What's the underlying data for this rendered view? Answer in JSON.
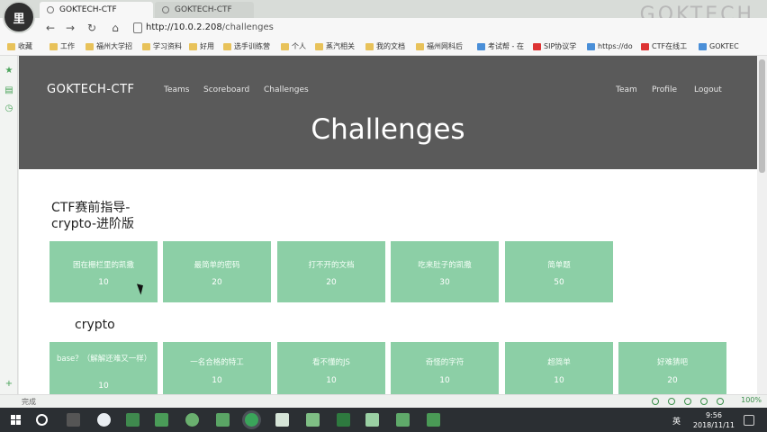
{
  "avatar": {
    "text": "里"
  },
  "tabs": [
    {
      "label": "GOKTECH-CTF"
    },
    {
      "label": "GOKTECH-CTF"
    }
  ],
  "watermark": "GOKTECH",
  "address": {
    "host": "http://10.0.2.208",
    "path": "/challenges"
  },
  "bookmarks": [
    {
      "label": "收藏",
      "icon": "star-icon"
    },
    {
      "label": "工作",
      "icon": "folder-icon"
    },
    {
      "label": "福州大学招",
      "icon": "folder-icon"
    },
    {
      "label": "学习资料",
      "icon": "folder-icon"
    },
    {
      "label": "好用",
      "icon": "folder-icon"
    },
    {
      "label": "选手训练营",
      "icon": "folder-icon"
    },
    {
      "label": "个人",
      "icon": "folder-icon"
    },
    {
      "label": "蒸汽相关",
      "icon": "folder-icon"
    },
    {
      "label": "我的文档",
      "icon": "folder-icon"
    },
    {
      "label": "福州网科后",
      "icon": "folder-icon"
    },
    {
      "label": "考试帮 - 在",
      "icon": "page-icon"
    },
    {
      "label": "SIP协议学",
      "icon": "page-icon"
    },
    {
      "label": "https://do",
      "icon": "page-icon"
    },
    {
      "label": "CTF在线工",
      "icon": "page-icon"
    },
    {
      "label": "GOKTEC",
      "icon": "page-icon"
    }
  ],
  "site": {
    "brand": "GOKTECH-CTF",
    "nav_left": [
      "Teams",
      "Scoreboard",
      "Challenges"
    ],
    "nav_right": [
      "Team",
      "Profile",
      "Logout"
    ],
    "hero_title": "Challenges"
  },
  "categories": [
    {
      "title": "CTF赛前指导-crypto-进阶版",
      "challenges": [
        {
          "name": "困在栅栏里的凯撒",
          "points": "10"
        },
        {
          "name": "最简单的密码",
          "points": "20"
        },
        {
          "name": "打不开的文档",
          "points": "20"
        },
        {
          "name": "吃来肚子的凯撒",
          "points": "30"
        },
        {
          "name": "简单题",
          "points": "50"
        }
      ]
    },
    {
      "title": "crypto",
      "challenges": [
        {
          "name": "base？（解解还难又一样）",
          "points": "10"
        },
        {
          "name": "一名合格的特工",
          "points": "10"
        },
        {
          "name": "看不懂的JS",
          "points": "10"
        },
        {
          "name": "奇怪的字符",
          "points": "10"
        },
        {
          "name": "超简单",
          "points": "10"
        },
        {
          "name": "好难猜吧",
          "points": "20"
        }
      ]
    }
  ],
  "status": {
    "text": "完成",
    "zoom": "100%"
  },
  "clock": {
    "time": "9:56",
    "date": "2018/11/11"
  },
  "ime": "英",
  "colors": {
    "card": "#8ccfa6",
    "hero": "#5a5a5a",
    "taskbar": "#2b2f33"
  }
}
